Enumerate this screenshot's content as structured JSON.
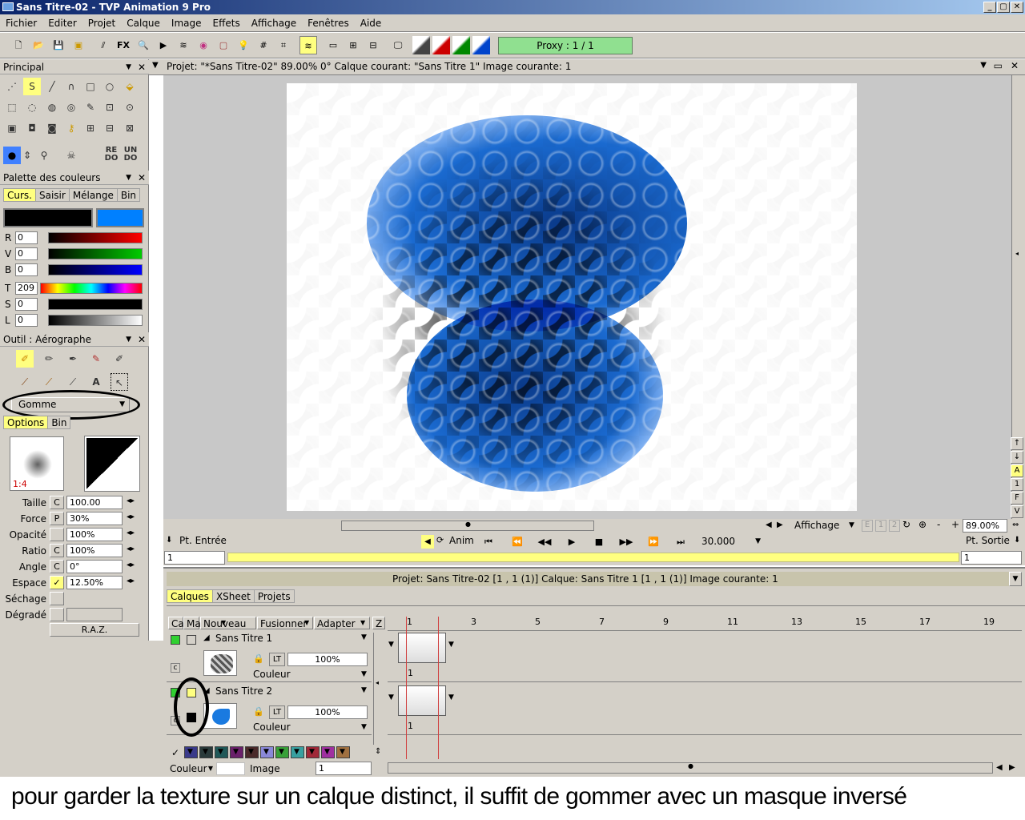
{
  "window": {
    "title": "Sans Titre-02 - TVP Animation 9 Pro",
    "min": "_",
    "max": "▢",
    "close": "✕"
  },
  "menu": [
    "Fichier",
    "Editer",
    "Projet",
    "Calque",
    "Image",
    "Effets",
    "Affichage",
    "Fenêtres",
    "Aide"
  ],
  "toolbar": {
    "fx": "FX",
    "proxy": "Proxy : 1 / 1"
  },
  "principal": {
    "title": "Principal",
    "redo": "RE DO",
    "undo": "UN DO"
  },
  "palette": {
    "title": "Palette des couleurs",
    "tabs": [
      "Curs.",
      "Saisir",
      "Mélange",
      "Bin"
    ],
    "rows": [
      {
        "l": "R",
        "v": "0"
      },
      {
        "l": "V",
        "v": "0"
      },
      {
        "l": "B",
        "v": "0"
      },
      {
        "l": "T",
        "v": "209"
      },
      {
        "l": "S",
        "v": "0"
      },
      {
        "l": "L",
        "v": "0"
      }
    ],
    "colors": {
      "primary": "#000000",
      "secondary": "#0080ff"
    }
  },
  "outil": {
    "title": "Outil : Aérographe",
    "mode": "Gomme",
    "tabs": [
      "Options",
      "Bin"
    ],
    "ratio_label": "1:4",
    "params": [
      {
        "l": "Taille",
        "m": "C",
        "v": "100.00"
      },
      {
        "l": "Force",
        "m": "P",
        "v": "30%"
      },
      {
        "l": "Opacité",
        "m": "",
        "v": "100%"
      },
      {
        "l": "Ratio",
        "m": "C",
        "v": "100%"
      },
      {
        "l": "Angle",
        "m": "C",
        "v": "0°"
      },
      {
        "l": "Espace",
        "m": "✓",
        "v": "12.50%"
      },
      {
        "l": "Séchage",
        "m": "",
        "v": ""
      },
      {
        "l": "Dégradé",
        "m": "",
        "v": ""
      }
    ],
    "reset": "R.A.Z."
  },
  "project_bar": "Projet: \"*Sans Titre-02\"  89.00%  0°  Calque courant: \"Sans Titre 1\"  Image courante: 1",
  "view": {
    "affichage": "Affichage",
    "zoom": "89.00%",
    "pt_entree": "Pt. Entrée",
    "pt_sortie": "Pt. Sortie",
    "anim": "Anim",
    "fps": "30.000",
    "in_val": "1",
    "out_val": "1",
    "side": [
      "↑",
      "↓",
      "A",
      "1",
      "F",
      "V"
    ],
    "btns": [
      "E",
      "1",
      "2",
      "↻",
      "⊕",
      "-",
      "+"
    ]
  },
  "timeline": {
    "info": "Projet: Sans Titre-02 [1 , 1  (1)]      Calque: Sans Titre 1 [1 , 1  (1)]      Image courante: 1",
    "tabs": [
      "Calques",
      "XSheet",
      "Projets"
    ],
    "cols": {
      "ca": "Ca",
      "ma": "Ma",
      "nouveau": "Nouveau",
      "fusionner": "Fusionner",
      "adapter": "Adapter",
      "z": "Z"
    },
    "frames": [
      "1",
      "3",
      "5",
      "7",
      "9",
      "11",
      "13",
      "15",
      "17",
      "19"
    ],
    "layers": [
      {
        "name": "Sans Titre 1",
        "opacity": "100%",
        "mode": "Couleur",
        "lt": "LT",
        "frame": "1"
      },
      {
        "name": "Sans Titre 2",
        "opacity": "100%",
        "mode": "Couleur",
        "lt": "LT",
        "frame": "1"
      }
    ],
    "bottom": {
      "couleur": "Couleur",
      "image": "Image",
      "image_val": "1"
    },
    "chips": [
      "#3a3a8a",
      "#2a3a3a",
      "#205858",
      "#6a206a",
      "#4a2a2a",
      "#8a88d8",
      "#38a038",
      "#38a0a0",
      "#a02838",
      "#a030a0",
      "#a07040"
    ]
  },
  "caption": "pour garder la texture sur un calque distinct, il suffit de gommer avec un masque inversé"
}
